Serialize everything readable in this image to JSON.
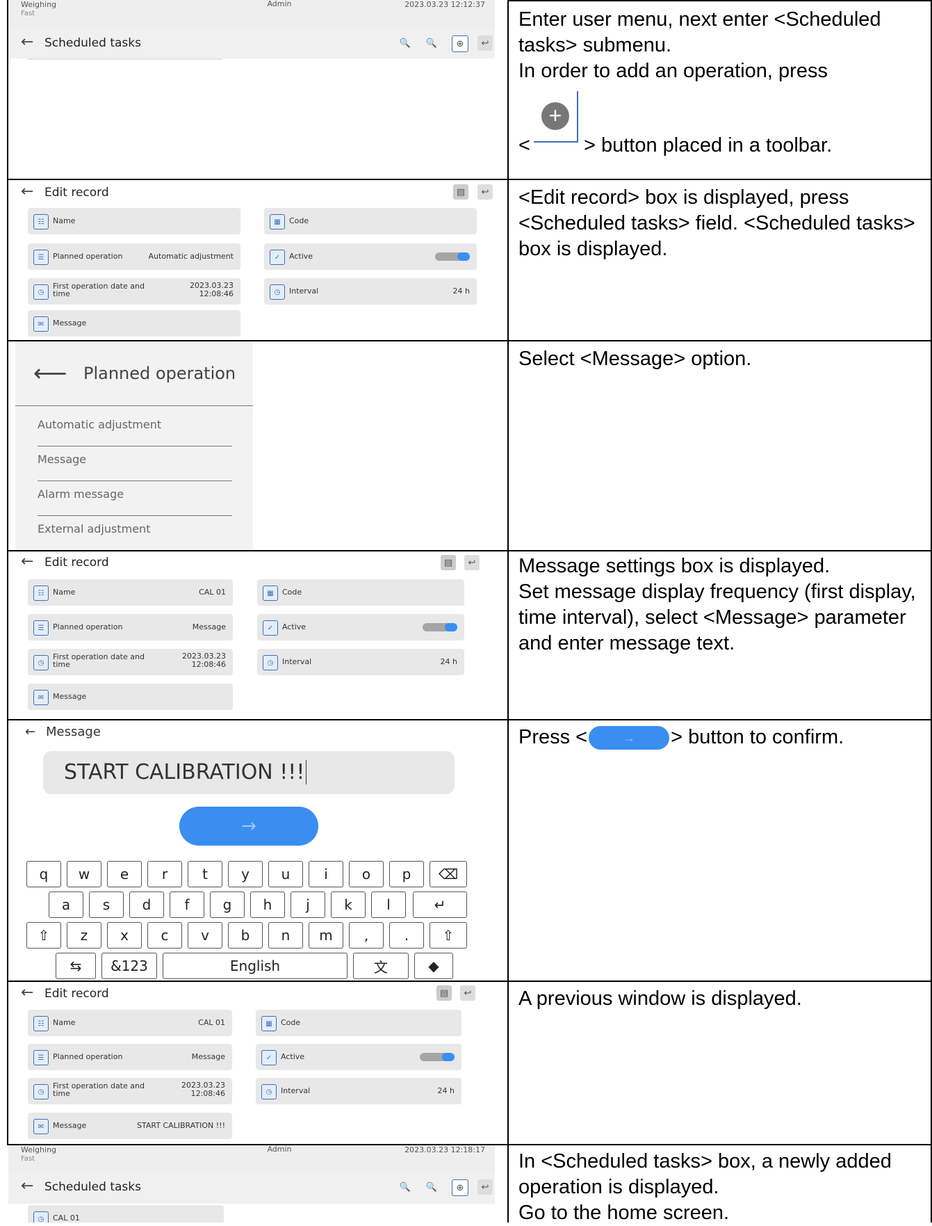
{
  "rows": [
    {
      "desc": [
        "Enter user menu, next enter <Scheduled tasks> submenu.",
        "In order to add an operation, press",
        "<",
        "> button placed in a toolbar."
      ]
    },
    {
      "desc": [
        "<Edit record> box is displayed, press <Scheduled tasks> field. <Scheduled tasks> box is displayed."
      ]
    },
    {
      "desc": [
        "Select <Message> option."
      ]
    },
    {
      "desc": [
        "Message settings box is displayed.",
        "Set message display frequency (first display, time interval), select <Message> parameter and enter message text."
      ]
    },
    {
      "desc": [
        "Press <",
        "> button to confirm."
      ]
    },
    {
      "desc": [
        "A previous window is displayed."
      ]
    },
    {
      "desc": [
        "In <Scheduled tasks> box, a newly added operation is displayed.",
        "Go to the home screen."
      ]
    }
  ],
  "status": {
    "mode": "Weighing",
    "sub": "Fast",
    "user": "Admin",
    "time1": "2023.03.23 12:12:37",
    "time2": "2023.03.23 12:18:17"
  },
  "scheduled": {
    "title": "Scheduled tasks",
    "item": "CAL 01"
  },
  "edit": {
    "title": "Edit record",
    "name_label": "Name",
    "code_label": "Code",
    "op_label": "Planned operation",
    "active_label": "Active",
    "first_label": "First operation date and time",
    "first_a": "First operation date and",
    "first_b": "time",
    "interval_label": "Interval",
    "message_label": "Message",
    "op_value1": "Automatic adjustment",
    "op_value2": "Message",
    "date": "2023.03.23",
    "clock": "12:08:46",
    "interval": "24 h",
    "name_value": "CAL 01",
    "message_value": "START CALIBRATION !!!"
  },
  "planned": {
    "title": "Planned operation",
    "options": [
      "Automatic adjustment",
      "Message",
      "Alarm message",
      "External adjustment"
    ]
  },
  "keyboard": {
    "title": "Message",
    "text": "START CALIBRATION !!!",
    "row1": [
      "q",
      "w",
      "e",
      "r",
      "t",
      "y",
      "u",
      "i",
      "o",
      "p"
    ],
    "row2": [
      "a",
      "s",
      "d",
      "f",
      "g",
      "h",
      "j",
      "k",
      "l"
    ],
    "row3": [
      "z",
      "x",
      "c",
      "v",
      "b",
      "n",
      "m",
      ",",
      "."
    ],
    "num": "&123",
    "lang": "English"
  },
  "colors": {
    "accent": "#3a8ef0",
    "field": "#e8e8e8",
    "bar": "#f0f0f0"
  }
}
